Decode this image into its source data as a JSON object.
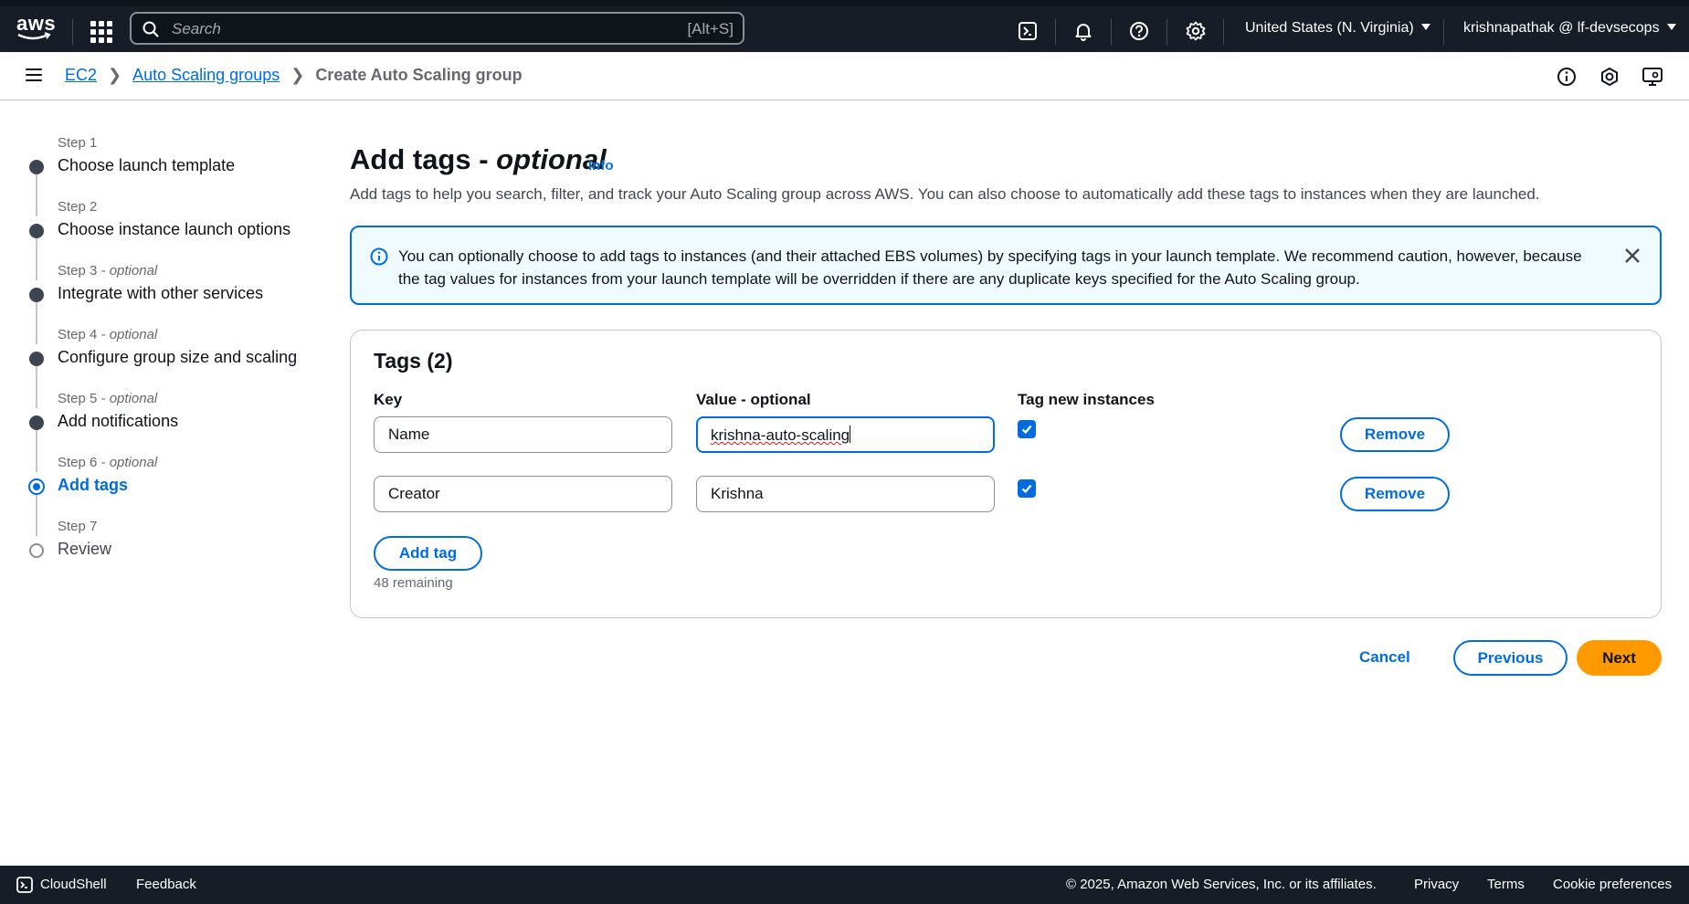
{
  "topbar": {
    "logo_text": "aws",
    "search_placeholder": "Search",
    "search_shortcut": "[Alt+S]",
    "region": "United States (N. Virginia)",
    "account": "krishnapathak @ lf-devsecops"
  },
  "breadcrumb": {
    "items": [
      "EC2",
      "Auto Scaling groups"
    ],
    "current": "Create Auto Scaling group"
  },
  "steps": [
    {
      "num": "Step 1",
      "optional": "",
      "label": "Choose launch template",
      "state": "done"
    },
    {
      "num": "Step 2",
      "optional": "",
      "label": "Choose instance launch options",
      "state": "done"
    },
    {
      "num": "Step 3",
      "optional": " - optional",
      "label": "Integrate with other services",
      "state": "done"
    },
    {
      "num": "Step 4",
      "optional": " - optional",
      "label": "Configure group size and scaling",
      "state": "done"
    },
    {
      "num": "Step 5",
      "optional": " - optional",
      "label": "Add notifications",
      "state": "done"
    },
    {
      "num": "Step 6",
      "optional": " - optional",
      "label": "Add tags",
      "state": "active"
    },
    {
      "num": "Step 7",
      "optional": "",
      "label": "Review",
      "state": "future"
    }
  ],
  "page": {
    "title": "Add tags - ",
    "title_optional": "optional",
    "info": "Info",
    "description": "Add tags to help you search, filter, and track your Auto Scaling group across AWS. You can also choose to automatically add these tags to instances when they are launched."
  },
  "alert": {
    "message": "You can optionally choose to add tags to instances (and their attached EBS volumes) by specifying tags in your launch template. We recommend caution, however, because the tag values for instances from your launch template will be overridden if there are any duplicate keys specified for the Auto Scaling group."
  },
  "tags": {
    "title": "Tags (2)",
    "col_key": "Key",
    "col_value": "Value - optional",
    "col_tag_new": "Tag new instances",
    "rows": [
      {
        "key": "Name",
        "value": "krishna-auto-scaling",
        "tag_new": true,
        "remove": "Remove"
      },
      {
        "key": "Creator",
        "value": "Krishna",
        "tag_new": true,
        "remove": "Remove"
      }
    ],
    "add_tag": "Add tag",
    "remaining": "48 remaining"
  },
  "actions": {
    "cancel": "Cancel",
    "previous": "Previous",
    "next": "Next"
  },
  "footer": {
    "cloudshell": "CloudShell",
    "feedback": "Feedback",
    "copyright": "© 2025, Amazon Web Services, Inc. or its affiliates.",
    "privacy": "Privacy",
    "terms": "Terms",
    "cookies": "Cookie preferences"
  },
  "colors": {
    "accent": "#006ce0",
    "primary_button": "#ff9900",
    "nav_bg": "#161d26"
  }
}
